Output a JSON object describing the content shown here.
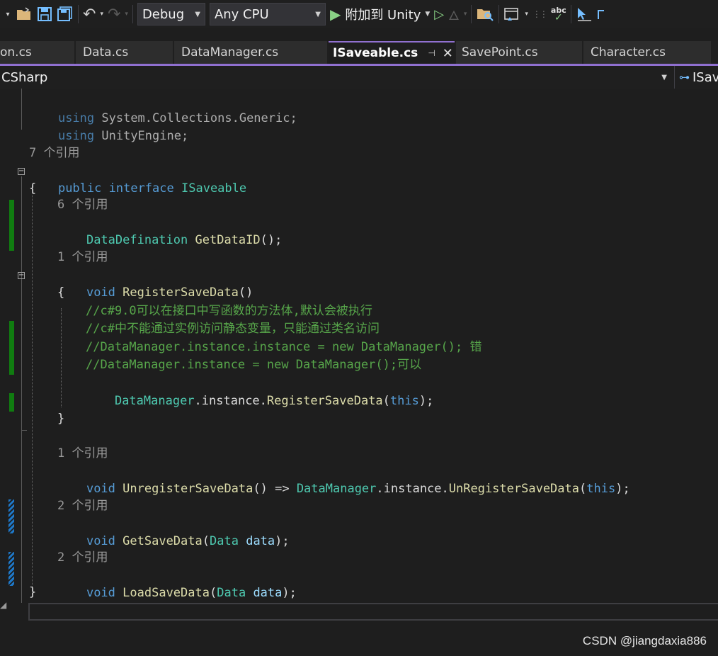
{
  "toolbar": {
    "config": "Debug",
    "platform": "Any CPU",
    "attach_label": "附加到 Unity",
    "spell_label": "abc"
  },
  "tabs": [
    {
      "label": "on.cs"
    },
    {
      "label": "Data.cs"
    },
    {
      "label": "DataManager.cs"
    },
    {
      "label": "ISaveable.cs"
    },
    {
      "label": "SavePoint.cs"
    },
    {
      "label": "Character.cs"
    }
  ],
  "navbar": {
    "project": "CSharp",
    "member": "ISav"
  },
  "code": {
    "l1_kw": "using",
    "l1_rest": " System.Collections.Generic;",
    "l2_kw": "using",
    "l2_rest": " UnityEngine;",
    "lens_iface": "7 个引用",
    "l5_kw1": "public",
    "l5_kw2": "interface",
    "l5_name": "ISaveable",
    "l6_brace": "{",
    "lens_getid": "6 个引用",
    "l8_type": "DataDefination",
    "l8_fn": "GetDataID",
    "l8_rest": "();",
    "lens_reg": "1 个引用",
    "l11_kw": "void",
    "l11_fn": "RegisterSaveData",
    "l11_rest": "()",
    "l12_brace": "{",
    "c1": "//c#9.0可以在接口中写函数的方法体,默认会被执行",
    "c2": "//c#中不能通过实例访问静态变量，只能通过类名访问",
    "c3": "//DataManager.instance.instance = new DataManager(); 错",
    "c4": "//DataManager.instance = new DataManager();可以",
    "l17_type": "DataManager",
    "l17_mid": ".instance.",
    "l17_fn": "RegisterSaveData",
    "l17_p1": "(",
    "l17_this": "this",
    "l17_p2": ");",
    "l19_brace": "}",
    "lens_unreg": "1 个引用",
    "l22_kw": "void",
    "l22_fn": "UnregisterSaveData",
    "l22_mid": "() => ",
    "l22_type": "DataManager",
    "l22_mid2": ".instance.",
    "l22_fn2": "UnRegisterSaveData",
    "l22_p1": "(",
    "l22_this": "this",
    "l22_p2": ");",
    "lens_get": "2 个引用",
    "l25_kw": "void",
    "l25_fn": "GetSaveData",
    "l25_p1": "(",
    "l25_type": "Data",
    "l25_sp": " ",
    "l25_param": "data",
    "l25_p2": ");",
    "lens_load": "2 个引用",
    "l28_kw": "void",
    "l28_fn": "LoadSaveData",
    "l28_p1": "(",
    "l28_type": "Data",
    "l28_sp": " ",
    "l28_param": "data",
    "l28_p2": ");",
    "l29_brace": "}"
  },
  "watermark": "CSDN @jiangdaxia886"
}
